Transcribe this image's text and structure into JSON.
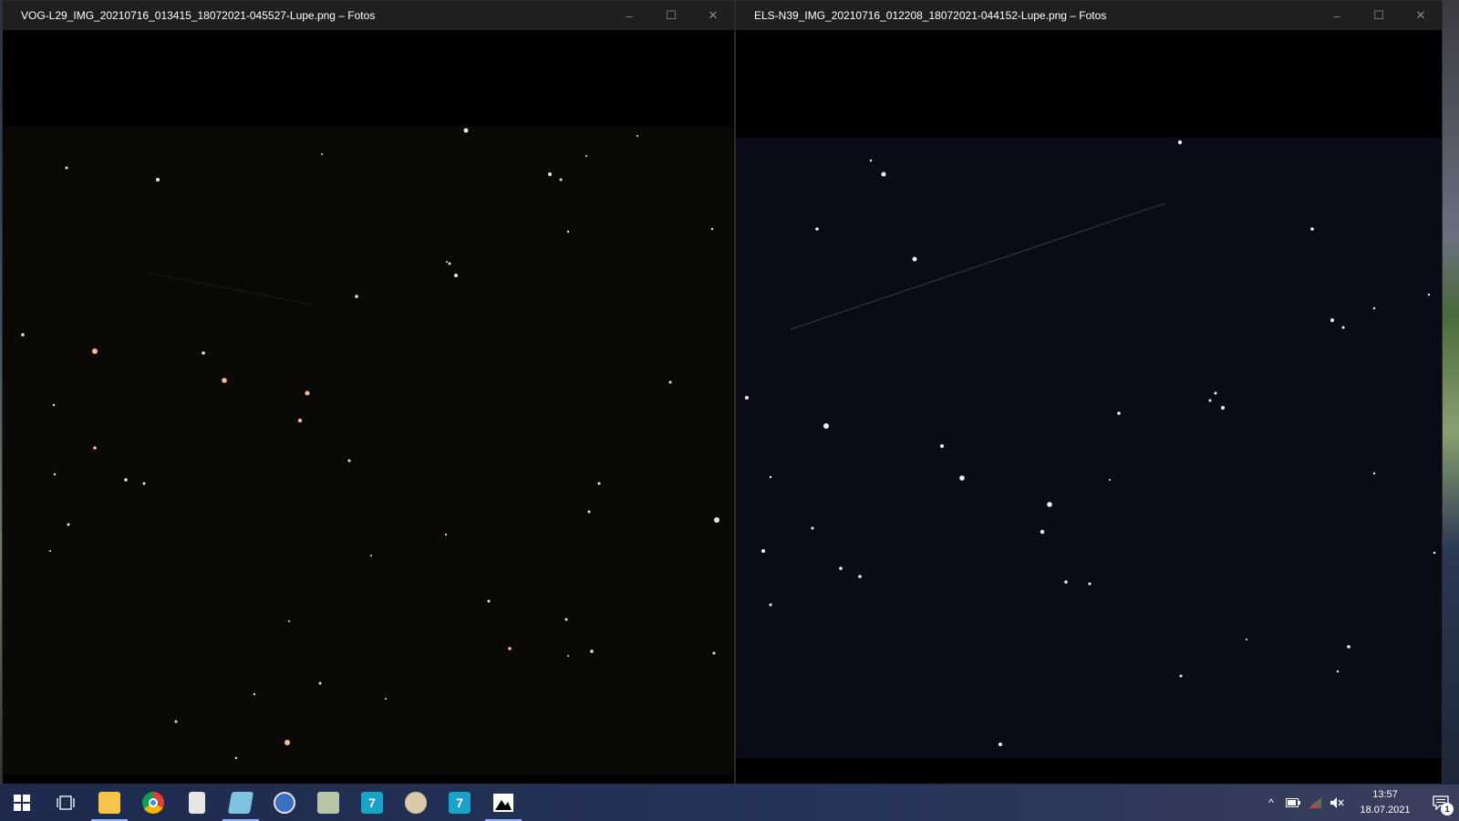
{
  "windows": [
    {
      "title": "VOG-L29_IMG_20210716_013415_18072021-045527-Lupe.png – Fotos",
      "controls": {
        "minimize": "–",
        "maximize": "☐",
        "close": "✕"
      }
    },
    {
      "title": "ELS-N39_IMG_20210716_012208_18072021-044152-Lupe.png – Fotos",
      "controls": {
        "minimize": "–",
        "maximize": "☐",
        "close": "✕"
      }
    }
  ],
  "taskbar": {
    "apps": [
      {
        "name": "start",
        "icon": "windows-logo-icon",
        "active": false
      },
      {
        "name": "task-view",
        "icon": "task-view-icon",
        "active": false
      },
      {
        "name": "file-explorer",
        "icon": "folder-icon",
        "active": true
      },
      {
        "name": "chrome",
        "icon": "chrome-icon",
        "active": false
      },
      {
        "name": "calculator",
        "icon": "calculator-icon",
        "active": false
      },
      {
        "name": "notepad",
        "icon": "notepad-icon",
        "active": true
      },
      {
        "name": "app-globe",
        "icon": "globe-icon",
        "active": false
      },
      {
        "name": "app-eye",
        "icon": "eye-icon",
        "active": false
      },
      {
        "name": "app-seven-a",
        "icon": "seven-icon",
        "active": false
      },
      {
        "name": "paint",
        "icon": "palette-icon",
        "active": false
      },
      {
        "name": "app-seven-b",
        "icon": "seven-icon",
        "active": false
      },
      {
        "name": "photos",
        "icon": "photos-icon",
        "active": true
      }
    ],
    "tray": {
      "chevron": "^",
      "time": "13:57",
      "date": "18.07.2021",
      "notification_count": "1"
    }
  },
  "colors": {
    "titlebar": "#1f1f1f",
    "taskbar": "#1d2a4d",
    "active_indicator": "#8fb4ff"
  }
}
